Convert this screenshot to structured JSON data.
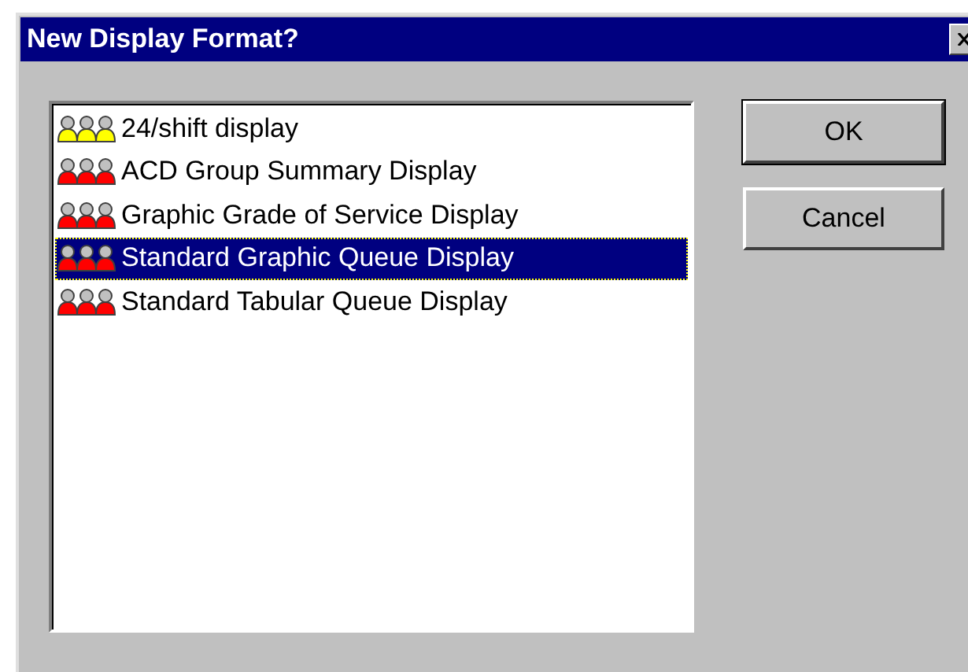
{
  "window": {
    "title": "New Display Format?"
  },
  "list": {
    "items": [
      {
        "label": "24/shift display",
        "color": "#ffff00",
        "selected": false
      },
      {
        "label": "ACD Group Summary Display",
        "color": "#ff0000",
        "selected": false
      },
      {
        "label": "Graphic Grade of Service Display",
        "color": "#ff0000",
        "selected": false
      },
      {
        "label": "Standard Graphic Queue Display",
        "color": "#ff0000",
        "selected": true
      },
      {
        "label": "Standard Tabular Queue Display",
        "color": "#ff0000",
        "selected": false
      }
    ]
  },
  "buttons": [
    {
      "label": "OK",
      "default": true
    },
    {
      "label": "Cancel",
      "default": false
    }
  ]
}
